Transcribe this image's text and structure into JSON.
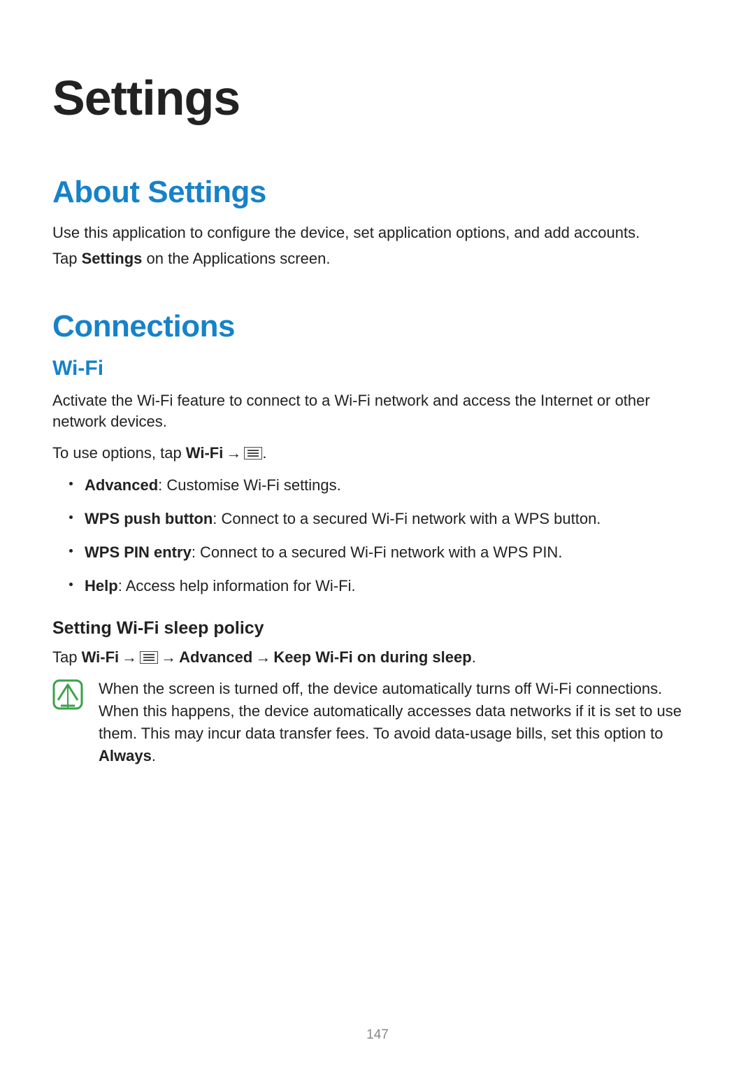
{
  "page_title": "Settings",
  "about": {
    "heading": "About Settings",
    "intro": "Use this application to configure the device, set application options, and add accounts.",
    "tap_prefix": "Tap ",
    "tap_bold": "Settings",
    "tap_suffix": " on the Applications screen."
  },
  "connections": {
    "heading": "Connections",
    "wifi": {
      "heading": "Wi-Fi",
      "intro": "Activate the Wi-Fi feature to connect to a Wi-Fi network and access the Internet or other network devices.",
      "options_prefix": "To use options, tap ",
      "options_bold": "Wi-Fi",
      "arrow": " → ",
      "options_period": ".",
      "options": [
        {
          "name": "Advanced",
          "desc": ": Customise Wi-Fi settings."
        },
        {
          "name": "WPS push button",
          "desc": ": Connect to a secured Wi-Fi network with a WPS button."
        },
        {
          "name": "WPS PIN entry",
          "desc": ": Connect to a secured Wi-Fi network with a WPS PIN."
        },
        {
          "name": "Help",
          "desc": ": Access help information for Wi-Fi."
        }
      ],
      "sleep": {
        "heading": "Setting Wi-Fi sleep policy",
        "path_prefix": "Tap ",
        "path_wifi": "Wi-Fi",
        "path_arrow1": " → ",
        "path_arrow2": " → ",
        "path_advanced": "Advanced",
        "path_arrow3": " → ",
        "path_keep": "Keep Wi-Fi on during sleep",
        "path_period": ".",
        "note_body": "When the screen is turned off, the device automatically turns off Wi-Fi connections. When this happens, the device automatically accesses data networks if it is set to use them. This may incur data transfer fees. To avoid data-usage bills, set this option to ",
        "note_always": "Always",
        "note_period": "."
      }
    }
  },
  "page_number": "147"
}
